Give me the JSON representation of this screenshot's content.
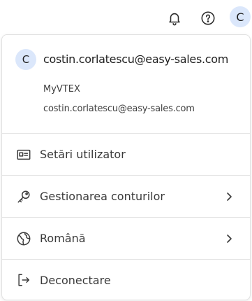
{
  "topbar": {
    "avatar_initial": "C",
    "icons": [
      "bell-icon",
      "help-circle-icon"
    ]
  },
  "profile": {
    "avatar_initial": "C",
    "email": "costin.corlatescu@easy-sales.com",
    "account": "MyVTEX",
    "sub_email": "costin.corlatescu@easy-sales.com"
  },
  "menu": {
    "user_settings": "Setări utilizator",
    "manage_accounts": "Gestionarea conturilor",
    "language": "Română",
    "logout": "Deconectare"
  },
  "colors": {
    "avatar_bg": "#dbe7fb",
    "border": "#e3e3e3",
    "text": "#3a3a3a"
  }
}
